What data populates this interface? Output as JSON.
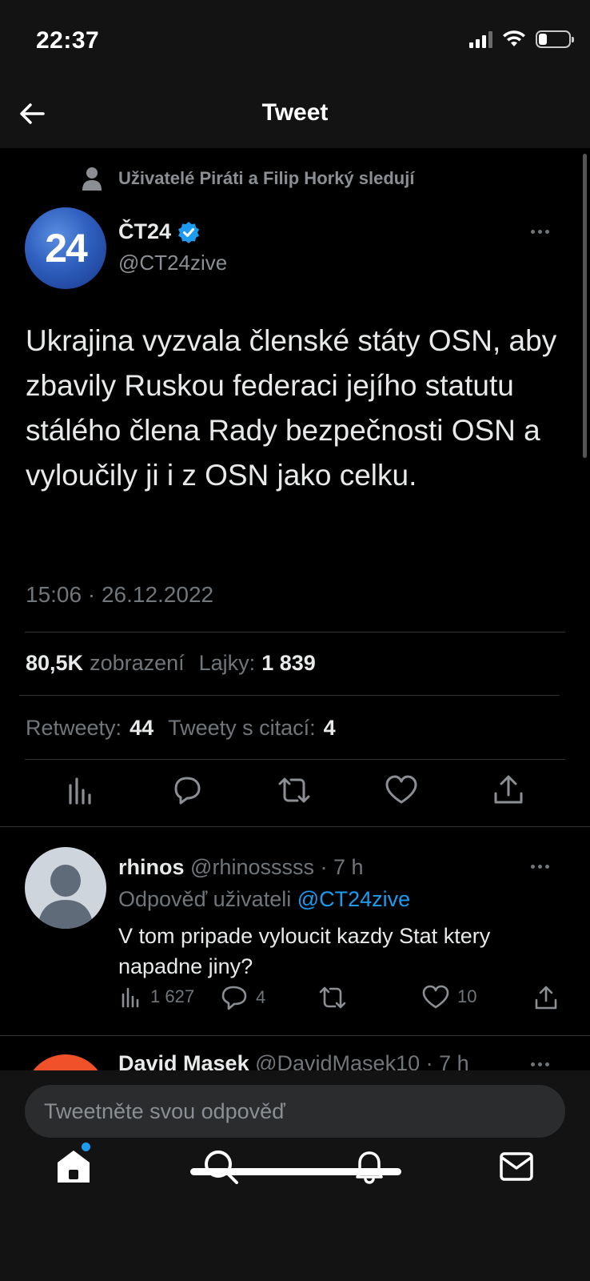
{
  "status_bar": {
    "time": "22:37"
  },
  "nav": {
    "title": "Tweet"
  },
  "tweet": {
    "social_context": "Uživatelé Piráti a Filip Horký sledují",
    "avatar_text": "24",
    "author_name": "ČT24",
    "author_handle": "@CT24zive",
    "text": "Ukrajina vyzvala členské státy OSN, aby zbavily Ruskou federaci jejího statutu stálého člena Rady bezpečnosti OSN a vyloučily ji i z OSN jako celku.",
    "timestamp": "15:06 · 26.12.2022",
    "views_value": "80,5K",
    "views_label": "zobrazení",
    "likes_label": "Lajky:",
    "likes_value": "1 839",
    "retweets_label": "Retweety:",
    "retweets_value": "44",
    "quotes_label": "Tweety s citací:",
    "quotes_value": "4"
  },
  "replies": [
    {
      "name": "rhinos",
      "handle": "@rhinosssss",
      "time": "· 7 h",
      "reply_to_label": "Odpověď uživateli",
      "reply_to_handle": "@CT24zive",
      "text": "V tom pripade vyloucit kazdy Stat ktery napadne jiny?",
      "views": "1 627",
      "comments": "4",
      "retweets": "",
      "likes": "10"
    },
    {
      "name": "David Masek",
      "handle": "@DavidMasek10",
      "time": "· 7 h"
    }
  ],
  "composer": {
    "placeholder": "Tweetněte svou odpověď"
  },
  "colors": {
    "accent": "#1d9bf0",
    "background": "#000000",
    "bar": "#131313",
    "secondary_text": "#71767b"
  },
  "icons": {
    "tabbar": [
      "home-icon",
      "search-icon",
      "notifications-bell-icon",
      "messages-mail-icon"
    ],
    "actions": [
      "analytics-icon",
      "reply-icon",
      "retweet-icon",
      "like-heart-icon",
      "share-icon"
    ]
  }
}
